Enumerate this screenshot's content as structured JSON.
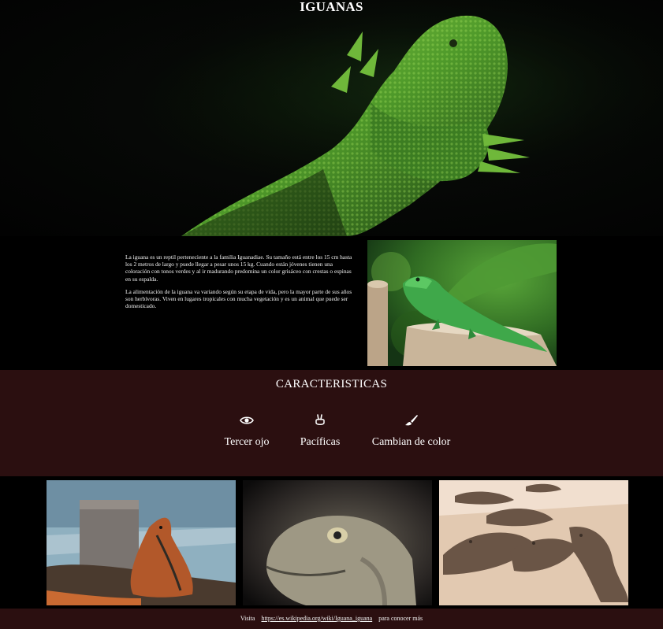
{
  "header": {
    "title": "IGUANAS"
  },
  "about": {
    "paragraphs": [
      "La iguana es un reptil perteneciente a la familia Iguanadiae. Su tamaño está entre los 15 cm hasta los 2 metros de largo y puede llegar a pesar unos 15 kg. Cuando están jóvenes tienen una coloración con tonos verdes y al ir madurando predomina un color grisáceo con crestas o espinas en su espalda.",
      "La alimentación de la iguana va variando según su etapa de vida, pero la mayor parte de sus años son herbívoras. Viven en lugares tropicales con mucha vegetación y es un animal que puede ser domesticado."
    ]
  },
  "features": {
    "title": "CARACTERISTICAS",
    "items": [
      {
        "label": "Tercer ojo",
        "icon": "eye-icon"
      },
      {
        "label": "Pacíficas",
        "icon": "peace-hand-icon"
      },
      {
        "label": "Cambian de color",
        "icon": "paint-brush-icon"
      }
    ]
  },
  "footer": {
    "prefix": "Visita",
    "link": "https://es.wikipedia.org/wiki/Iguana_iguana",
    "suffix": "para conocer más"
  },
  "colors": {
    "section_bg": "#2b0f10",
    "page_bg": "#000000",
    "text": "#ffffff"
  }
}
